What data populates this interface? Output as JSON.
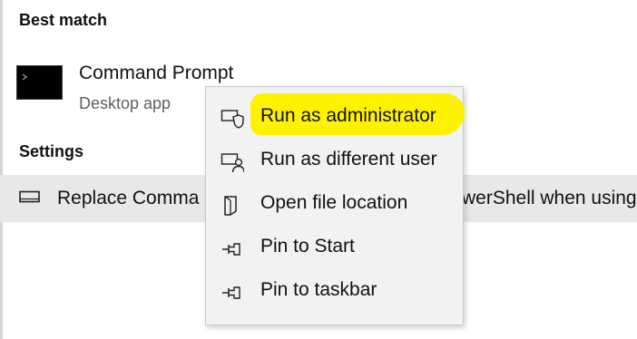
{
  "best_match": {
    "header": "Best match",
    "app_title": "Command Prompt",
    "app_subtitle": "Desktop app",
    "app_icon": "cmd-app-icon"
  },
  "settings": {
    "header": "Settings",
    "row_text_left": "Replace Comma",
    "row_text_right": "werShell when using",
    "row_icon": "monitor-icon"
  },
  "context_menu": {
    "items": [
      {
        "label": "Run as administrator",
        "icon": "run-as-admin-icon",
        "highlighted": true
      },
      {
        "label": "Run as different user",
        "icon": "run-as-user-icon"
      },
      {
        "label": "Open file location",
        "icon": "file-location-icon"
      },
      {
        "label": "Pin to Start",
        "icon": "pin-icon"
      },
      {
        "label": "Pin to taskbar",
        "icon": "pin-icon"
      }
    ]
  },
  "colors": {
    "highlight": "#fff200",
    "menu_bg": "#f2f2f2",
    "settings_row_bg": "#e8e8e8"
  }
}
